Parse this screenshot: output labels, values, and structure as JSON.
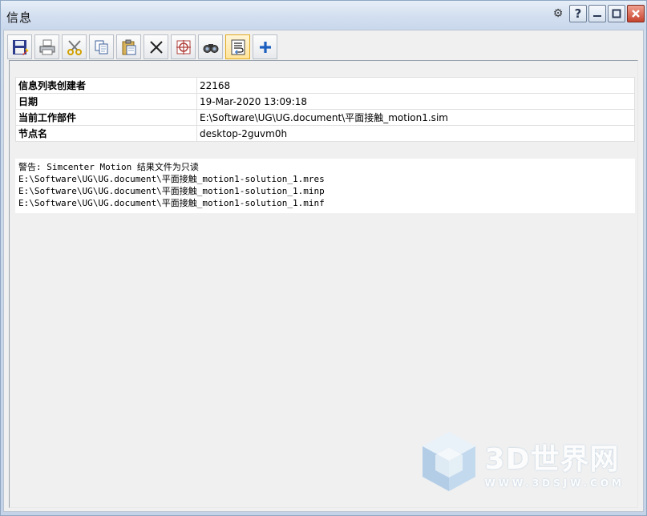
{
  "window": {
    "title": "信息",
    "buttons": {
      "help": "?",
      "minimize": "—",
      "maximize": "□",
      "close": "✕"
    }
  },
  "toolbar": {
    "tools": [
      {
        "icon": "save-icon",
        "active": false
      },
      {
        "icon": "print-icon",
        "active": false
      },
      {
        "icon": "cut-icon",
        "active": false
      },
      {
        "icon": "copy-icon",
        "active": false
      },
      {
        "icon": "paste-icon",
        "active": false
      },
      {
        "icon": "delete-icon",
        "active": false
      },
      {
        "icon": "target-icon",
        "active": false
      },
      {
        "icon": "binoculars-icon",
        "active": false
      },
      {
        "icon": "word-wrap-icon",
        "active": true
      },
      {
        "icon": "plus-icon",
        "active": false
      }
    ]
  },
  "info": {
    "rows": [
      {
        "key": "信息列表创建者",
        "value": "22168"
      },
      {
        "key": "日期",
        "value": "19-Mar-2020 13:09:18"
      },
      {
        "key": "当前工作部件",
        "value": "E:\\Software\\UG\\UG.document\\平面接触_motion1.sim"
      },
      {
        "key": "节点名",
        "value": "desktop-2guvm0h"
      }
    ],
    "messages": [
      "警告: Simcenter Motion 结果文件为只读",
      "E:\\Software\\UG\\UG.document\\平面接触_motion1-solution_1.mres",
      "E:\\Software\\UG\\UG.document\\平面接触_motion1-solution_1.minp",
      "E:\\Software\\UG\\UG.document\\平面接触_motion1-solution_1.minf"
    ]
  },
  "watermark": {
    "main": "3D世界网",
    "sub": "WWW.3DSJW.COM"
  },
  "colors": {
    "accent_active_tool": "#ffe39a",
    "close_button": "#c7442e",
    "plus_icon": "#1d5fbf"
  }
}
